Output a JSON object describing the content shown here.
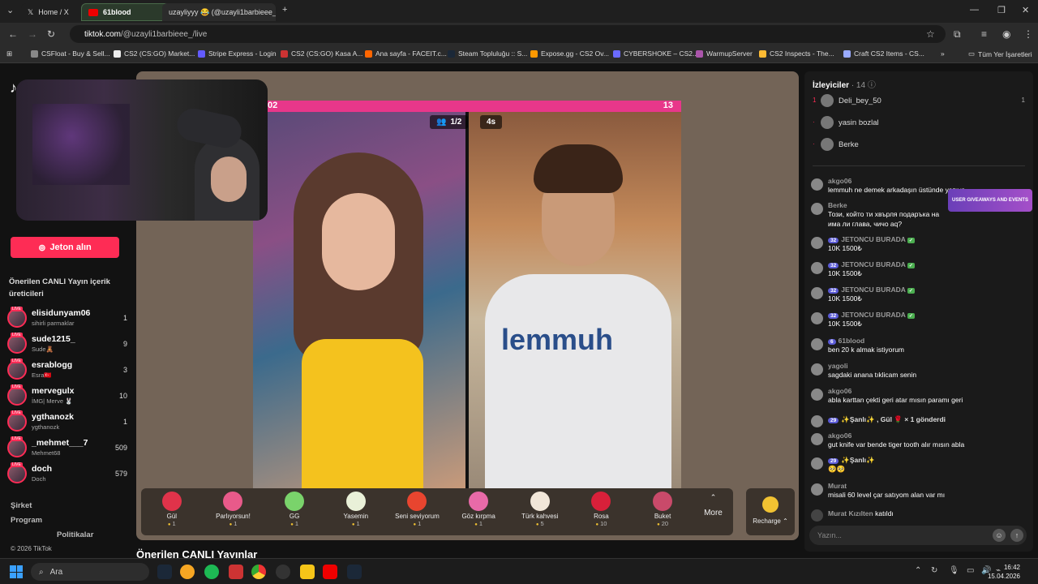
{
  "browser": {
    "tabs": [
      {
        "label": "Home / X"
      },
      {
        "label": "61blood"
      },
      {
        "label": "uzayliyyy 😂 (@uzayli1barbieee_)"
      }
    ],
    "url_host": "tiktok.com",
    "url_path": "/@uzayli1barbieee_/live",
    "bookmarks": [
      "CSFloat - Buy & Sell...",
      "CS2 (CS:GO) Market...",
      "Stripe Express - Login",
      "CS2 (CS:GO) Kasa A...",
      "Ana sayfa - FACEIT.c...",
      "Steam Topluluğu :: S...",
      "Expose.gg - CS2 Ov...",
      "CYBERSHOKE – CS2...",
      "WarmupServer",
      "CS2 Inspects - The...",
      "Craft CS2 Items - CS..."
    ],
    "all_bookmarks": "Tüm Yer İşaretleri"
  },
  "sidebar": {
    "jeton_button": "Jeton alın",
    "suggested_title": "Önerilen CANLI Yayın içerik üreticileri",
    "creators": [
      {
        "name": "elisidunyam06",
        "sub": "sihirli parmaklar",
        "count": "1"
      },
      {
        "name": "sude1215_",
        "sub": "Sude🧸",
        "count": "9"
      },
      {
        "name": "esrablogg",
        "sub": "Esra🇹🇷",
        "count": "3"
      },
      {
        "name": "mervegulx",
        "sub": "İMG| Merve 🐰",
        "count": "10"
      },
      {
        "name": "ygthanozk",
        "sub": "ygthanozk",
        "count": "1"
      },
      {
        "name": "_mehmet___7",
        "sub": "Mehmet68",
        "count": "509"
      },
      {
        "name": "doch",
        "sub": "Doch",
        "count": "579"
      }
    ],
    "footer": [
      "Şirket",
      "Program",
      "Politikalar"
    ],
    "copyright": "© 2026 TikTok"
  },
  "battle": {
    "left_score": "02",
    "right_score": "13",
    "round": "1/2",
    "timer": "4s",
    "right_shirt": "lemmuh"
  },
  "gifts": [
    {
      "name": "Gül",
      "price": "1",
      "color": "#e0334a"
    },
    {
      "name": "Parlıyorsun!",
      "price": "1",
      "color": "#e85a8a"
    },
    {
      "name": "GG",
      "price": "1",
      "color": "#7ad36b"
    },
    {
      "name": "Yasemin",
      "price": "1",
      "color": "#e9f0d8"
    },
    {
      "name": "Seni seviyorum",
      "price": "1",
      "color": "#e8452f"
    },
    {
      "name": "Göz kırpma",
      "price": "1",
      "color": "#e86aa8"
    },
    {
      "name": "Türk kahvesi",
      "price": "5",
      "color": "#f1e6d8"
    },
    {
      "name": "Rosa",
      "price": "10",
      "color": "#d8203a"
    },
    {
      "name": "Buket",
      "price": "20",
      "color": "#c94a6a"
    }
  ],
  "more_label": "More",
  "recharge_label": "Recharge",
  "section_heading": "Önerilen CANLI Yayınlar",
  "chat": {
    "viewers_title": "İzleyiciler",
    "viewers_count": "· 14",
    "viewers": [
      {
        "rank": "1",
        "name": "Deli_bey_50",
        "score": "1"
      },
      {
        "rank": "·",
        "name": "yasin bozlal",
        "score": ""
      },
      {
        "rank": "·",
        "name": "Berke",
        "score": ""
      }
    ],
    "messages": [
      {
        "user": "akgo06",
        "badge": "",
        "text": "lemmuh ne demek arkadaşın üstünde yazıyo"
      },
      {
        "user": "Berke",
        "badge": "",
        "text": "Този, който ти хвърля подаръка на"
      },
      {
        "user": "",
        "badge": "",
        "text": "има ли глава, чичо аq?"
      },
      {
        "user": "JETONCU BURADA",
        "badge": "32",
        "text": "10K 1500₺"
      },
      {
        "user": "JETONCU BURADA",
        "badge": "32",
        "text": "10K 1500₺"
      },
      {
        "user": "JETONCU BURADA",
        "badge": "32",
        "text": "10K 1500₺"
      },
      {
        "user": "JETONCU BURADA",
        "badge": "32",
        "text": "10K 1500₺"
      },
      {
        "user": "61blood",
        "badge": "6",
        "text": "ben 20 k almak istiyorum"
      },
      {
        "user": "yagoli",
        "badge": "",
        "text": "sagdaki anana tıklicam senin"
      },
      {
        "user": "akgo06",
        "badge": "",
        "text": "abla karttan çekti geri atar mısın paramı geri"
      },
      {
        "user": "✨Şanlı✨ , Gül 🌹 × 1 gönderdi",
        "badge": "29",
        "text": ""
      },
      {
        "user": "akgo06",
        "badge": "",
        "text": "gut knife var bende tiger tooth alır mısın abla"
      },
      {
        "user": "✨Şanlı✨",
        "badge": "29",
        "text": "🥺🥺"
      },
      {
        "user": "Murat",
        "badge": "",
        "text": "misali 60 level çar satıyom alan var mı"
      },
      {
        "user": "Murat Kızılten",
        "badge": "",
        "text": "katıldı"
      }
    ],
    "promo": "USER GIVEAWAYS AND EVENTS",
    "input_placeholder": "Yazın..."
  },
  "taskbar": {
    "search": "Ara",
    "time": "16:42",
    "date": "15.04.2026"
  }
}
